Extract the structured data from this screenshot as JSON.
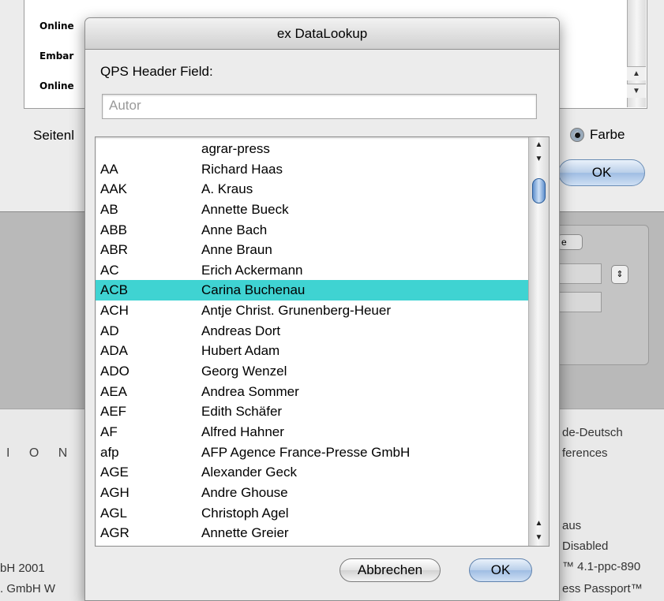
{
  "background": {
    "list_items": [
      "Online",
      "Embar",
      "Online"
    ],
    "seiten_label": "Seitenl",
    "farbe_label": "Farbe",
    "ok_label": "OK",
    "gray_button_label": "e",
    "left_texts": [
      "I O N S",
      "bH 2001",
      ". GmbH W"
    ],
    "right_texts": [
      "de-Deutsch",
      "ferences",
      "aus",
      "Disabled",
      "™ 4.1-ppc-890",
      "ess Passport™"
    ]
  },
  "dialog": {
    "title": "ex DataLookup",
    "field_label": "QPS Header Field:",
    "search_value": "Autor",
    "selected_index": 7,
    "rows": [
      {
        "code": "",
        "name": "agrar-press"
      },
      {
        "code": "AA",
        "name": "Richard Haas"
      },
      {
        "code": "AAK",
        "name": "A. Kraus"
      },
      {
        "code": "AB",
        "name": "Annette Bueck"
      },
      {
        "code": "ABB",
        "name": "Anne Bach"
      },
      {
        "code": "ABR",
        "name": "Anne Braun"
      },
      {
        "code": "AC",
        "name": "Erich Ackermann"
      },
      {
        "code": "ACB",
        "name": "Carina Buchenau"
      },
      {
        "code": "ACH",
        "name": "Antje Christ. Grunenberg-Heuer"
      },
      {
        "code": "AD",
        "name": "Andreas Dort"
      },
      {
        "code": "ADA",
        "name": "Hubert Adam"
      },
      {
        "code": "ADO",
        "name": "Georg Wenzel"
      },
      {
        "code": "AEA",
        "name": "Andrea Sommer"
      },
      {
        "code": "AEF",
        "name": "Edith Schäfer"
      },
      {
        "code": "AF",
        "name": "Alfred Hahner"
      },
      {
        "code": "afp",
        "name": "AFP Agence France-Presse GmbH"
      },
      {
        "code": "AGE",
        "name": "Alexander Geck"
      },
      {
        "code": "AGH",
        "name": "Andre Ghouse"
      },
      {
        "code": "AGL",
        "name": "Christoph Agel"
      },
      {
        "code": "AGR",
        "name": "Annette Greier"
      }
    ],
    "cancel_label": "Abbrechen",
    "ok_label": "OK"
  },
  "colors": {
    "selection": "#3fd3d2",
    "default_button": "#9fbde3"
  },
  "icons": [
    "scroll-up-arrow-icon",
    "scroll-down-arrow-icon",
    "radio-selected-icon",
    "stepper-icon"
  ]
}
